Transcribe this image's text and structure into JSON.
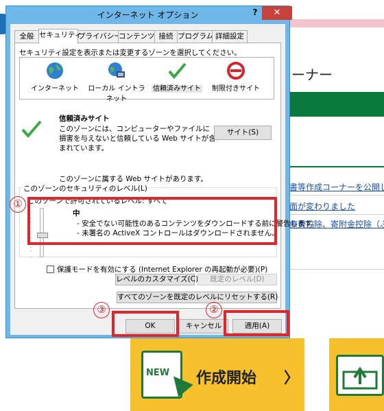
{
  "background": {
    "corner_text": "ーナー",
    "links": [
      "書等作成コーナーを公開し",
      "面が変わりました",
      "療費控除、寄附金控除（ぶ"
    ],
    "banner_badge": "NEW",
    "banner_text": "作成開始",
    "banner_chevron": "〉"
  },
  "dialog": {
    "title": "インターネット オプション",
    "help": "?",
    "close": "✕",
    "tabs": [
      "全般",
      "セキュリティ",
      "プライバシー",
      "コンテンツ",
      "接続",
      "プログラム",
      "詳細設定"
    ],
    "zone_instruction": "セキュリティ設定を表示または変更するゾーンを選択してください。",
    "zones": [
      {
        "label": "インターネット",
        "icon": "globe-icon"
      },
      {
        "label": "ローカル イントラネット",
        "icon": "intranet-icon"
      },
      {
        "label": "信頼済みサイト",
        "icon": "checkmark-icon"
      },
      {
        "label": "制限付きサイト",
        "icon": "restricted-icon"
      }
    ],
    "selected_zone_title": "信頼済みサイト",
    "selected_zone_desc": "このゾーンには、コンピューターやファイルに損害を与えないと信頼している Web サイトが含まれています。",
    "sites_button": "サイト(S)",
    "zone_sites_text": "このゾーンに属する Web サイトがあります。",
    "security_level_group": "このゾーンのセキュリティのレベル(L)",
    "allowed_levels": "このゾーンで許可されているレベル: すべて",
    "level_name": "中",
    "level_desc_1": "- 安全でない可能性のあるコンテンツをダウンロードする前に警告します。",
    "level_desc_2": "- 未署名の ActiveX コントロールはダウンロードされません。",
    "protected_mode": "保護モードを有効にする (Internet Explorer の再起動が必要)(P)",
    "custom_level_button": "レベルのカスタマイズ(C)...",
    "default_level_button": "既定のレベル(D)",
    "reset_all_button": "すべてのゾーンを既定のレベルにリセットする(R)",
    "ok_button": "OK",
    "cancel_button": "キャンセル",
    "apply_button": "適用(A)"
  },
  "annotations": [
    "①",
    "②",
    "③"
  ],
  "colors": {
    "annotation_red": "#e0252b",
    "title_blue": "#6fb6e9",
    "close_red": "#c7423a",
    "banner_yellow": "#f7c12e",
    "green": "#0a7a3c"
  }
}
